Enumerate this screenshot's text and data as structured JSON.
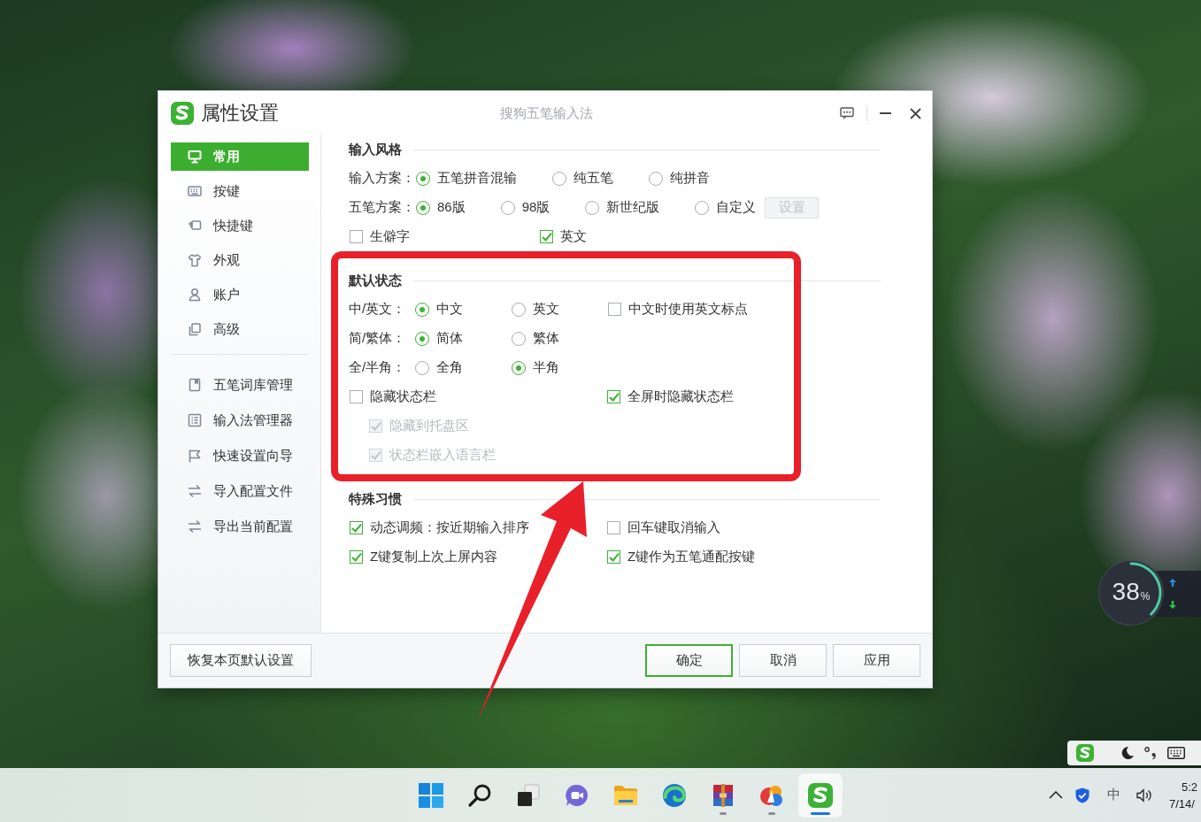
{
  "window": {
    "title": "属性设置",
    "app_name": "搜狗五笔输入法"
  },
  "sidebar": {
    "items": [
      {
        "label": "常用",
        "selected": true
      },
      {
        "label": "按键",
        "selected": false
      },
      {
        "label": "快捷键",
        "selected": false
      },
      {
        "label": "外观",
        "selected": false
      },
      {
        "label": "账户",
        "selected": false
      },
      {
        "label": "高级",
        "selected": false
      }
    ],
    "tools": [
      {
        "label": "五笔词库管理"
      },
      {
        "label": "输入法管理器"
      },
      {
        "label": "快速设置向导"
      },
      {
        "label": "导入配置文件"
      },
      {
        "label": "导出当前配置"
      }
    ]
  },
  "sections": [
    {
      "title": "输入风格",
      "rows": [
        {
          "label": "输入方案：",
          "options": [
            {
              "kind": "radio",
              "label": "五笔拼音混输",
              "selected": true
            },
            {
              "kind": "radio",
              "label": "纯五笔",
              "selected": false
            },
            {
              "kind": "radio",
              "label": "纯拼音",
              "selected": false
            }
          ]
        },
        {
          "label": "五笔方案：",
          "options": [
            {
              "kind": "radio",
              "label": "86版",
              "selected": true
            },
            {
              "kind": "radio",
              "label": "98版",
              "selected": false
            },
            {
              "kind": "radio",
              "label": "新世纪版",
              "selected": false
            },
            {
              "kind": "radio",
              "label": "自定义",
              "selected": false
            }
          ],
          "button": {
            "label": "设置",
            "disabled": true
          }
        },
        {
          "options": [
            {
              "kind": "checkbox",
              "label": "生僻字",
              "checked": false
            },
            {
              "kind": "checkbox",
              "label": "英文",
              "checked": true
            }
          ]
        }
      ]
    },
    {
      "title": "默认状态",
      "rows": [
        {
          "label": "中/英文：",
          "options": [
            {
              "kind": "radio",
              "label": "中文",
              "selected": true
            },
            {
              "kind": "radio",
              "label": "英文",
              "selected": false
            },
            {
              "kind": "checkbox",
              "label": "中文时使用英文标点",
              "checked": false
            }
          ]
        },
        {
          "label": "简/繁体：",
          "options": [
            {
              "kind": "radio",
              "label": "简体",
              "selected": true
            },
            {
              "kind": "radio",
              "label": "繁体",
              "selected": false
            }
          ]
        },
        {
          "label": "全/半角：",
          "options": [
            {
              "kind": "radio",
              "label": "全角",
              "selected": false
            },
            {
              "kind": "radio",
              "label": "半角",
              "selected": true
            }
          ]
        },
        {
          "options": [
            {
              "kind": "checkbox",
              "label": "隐藏状态栏",
              "checked": false,
              "children": [
                {
                  "kind": "checkbox",
                  "label": "隐藏到托盘区",
                  "checked": true,
                  "disabled": true
                },
                {
                  "kind": "checkbox",
                  "label": "状态栏嵌入语言栏",
                  "checked": true,
                  "disabled": true
                }
              ]
            },
            {
              "kind": "checkbox",
              "label": "全屏时隐藏状态栏",
              "checked": true
            }
          ]
        }
      ]
    },
    {
      "title": "特殊习惯",
      "rows": [
        {
          "options": [
            {
              "kind": "checkbox",
              "label": "动态调频：按近期输入排序",
              "checked": true
            },
            {
              "kind": "checkbox",
              "label": "回车键取消输入",
              "checked": false
            }
          ]
        },
        {
          "options": [
            {
              "kind": "checkbox",
              "label": "Z键复制上次上屏内容",
              "checked": true
            },
            {
              "kind": "checkbox",
              "label": "Z键作为五笔通配按键",
              "checked": true
            }
          ]
        }
      ]
    }
  ],
  "footer": {
    "reset_button": "恢复本页默认设置",
    "buttons": [
      {
        "label": "确定",
        "default": true
      },
      {
        "label": "取消",
        "default": false
      },
      {
        "label": "应用",
        "default": false
      }
    ]
  },
  "widget": {
    "value": "38",
    "unit": "%"
  },
  "taskbar": {
    "apps": [
      {
        "selected": false,
        "running": false
      },
      {
        "selected": false,
        "running": false
      },
      {
        "selected": false,
        "running": false
      },
      {
        "selected": false,
        "running": false
      },
      {
        "selected": false,
        "running": false
      },
      {
        "selected": false,
        "running": false
      },
      {
        "selected": false,
        "running": true
      },
      {
        "selected": false,
        "running": true
      },
      {
        "selected": true,
        "running": true
      }
    ],
    "tray": {
      "ime": "中",
      "time": "5:2",
      "date": "7/14/"
    }
  }
}
